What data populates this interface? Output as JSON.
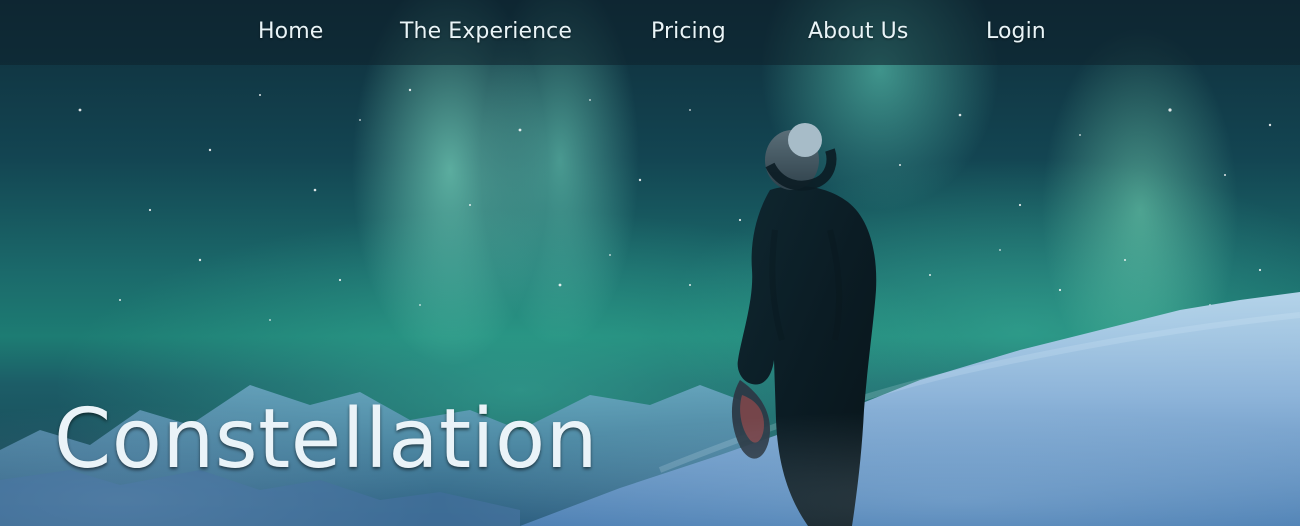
{
  "nav": {
    "items": [
      {
        "label": "Home"
      },
      {
        "label": "The Experience"
      },
      {
        "label": "Pricing"
      },
      {
        "label": "About Us"
      },
      {
        "label": "Login"
      }
    ]
  },
  "hero": {
    "title": "Constellation",
    "image": {
      "icon": "aurora-night-sky-person-illustration"
    }
  },
  "colors": {
    "nav_bg": "#0d232d",
    "text": "#eaf3f8",
    "aurora": "#5de3c6",
    "snow": "#b7d2ec"
  }
}
